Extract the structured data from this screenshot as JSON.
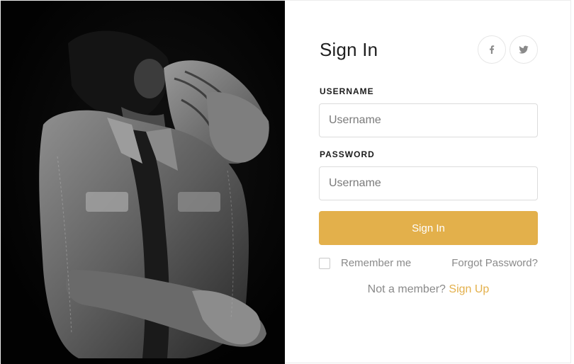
{
  "form": {
    "title": "Sign In",
    "username_label": "USERNAME",
    "username_placeholder": "Username",
    "password_label": "PASSWORD",
    "password_placeholder": "Username",
    "submit_label": "Sign In",
    "remember_label": "Remember me",
    "forgot_label": "Forgot Password?",
    "signup_prompt": "Not a member?",
    "signup_link": "Sign Up"
  },
  "social": [
    {
      "icon": "facebook-icon"
    },
    {
      "icon": "twitter-icon"
    }
  ],
  "colors": {
    "accent": "#e3b04b",
    "photo_background": "#030303",
    "muted_text": "#8a8a8a"
  }
}
